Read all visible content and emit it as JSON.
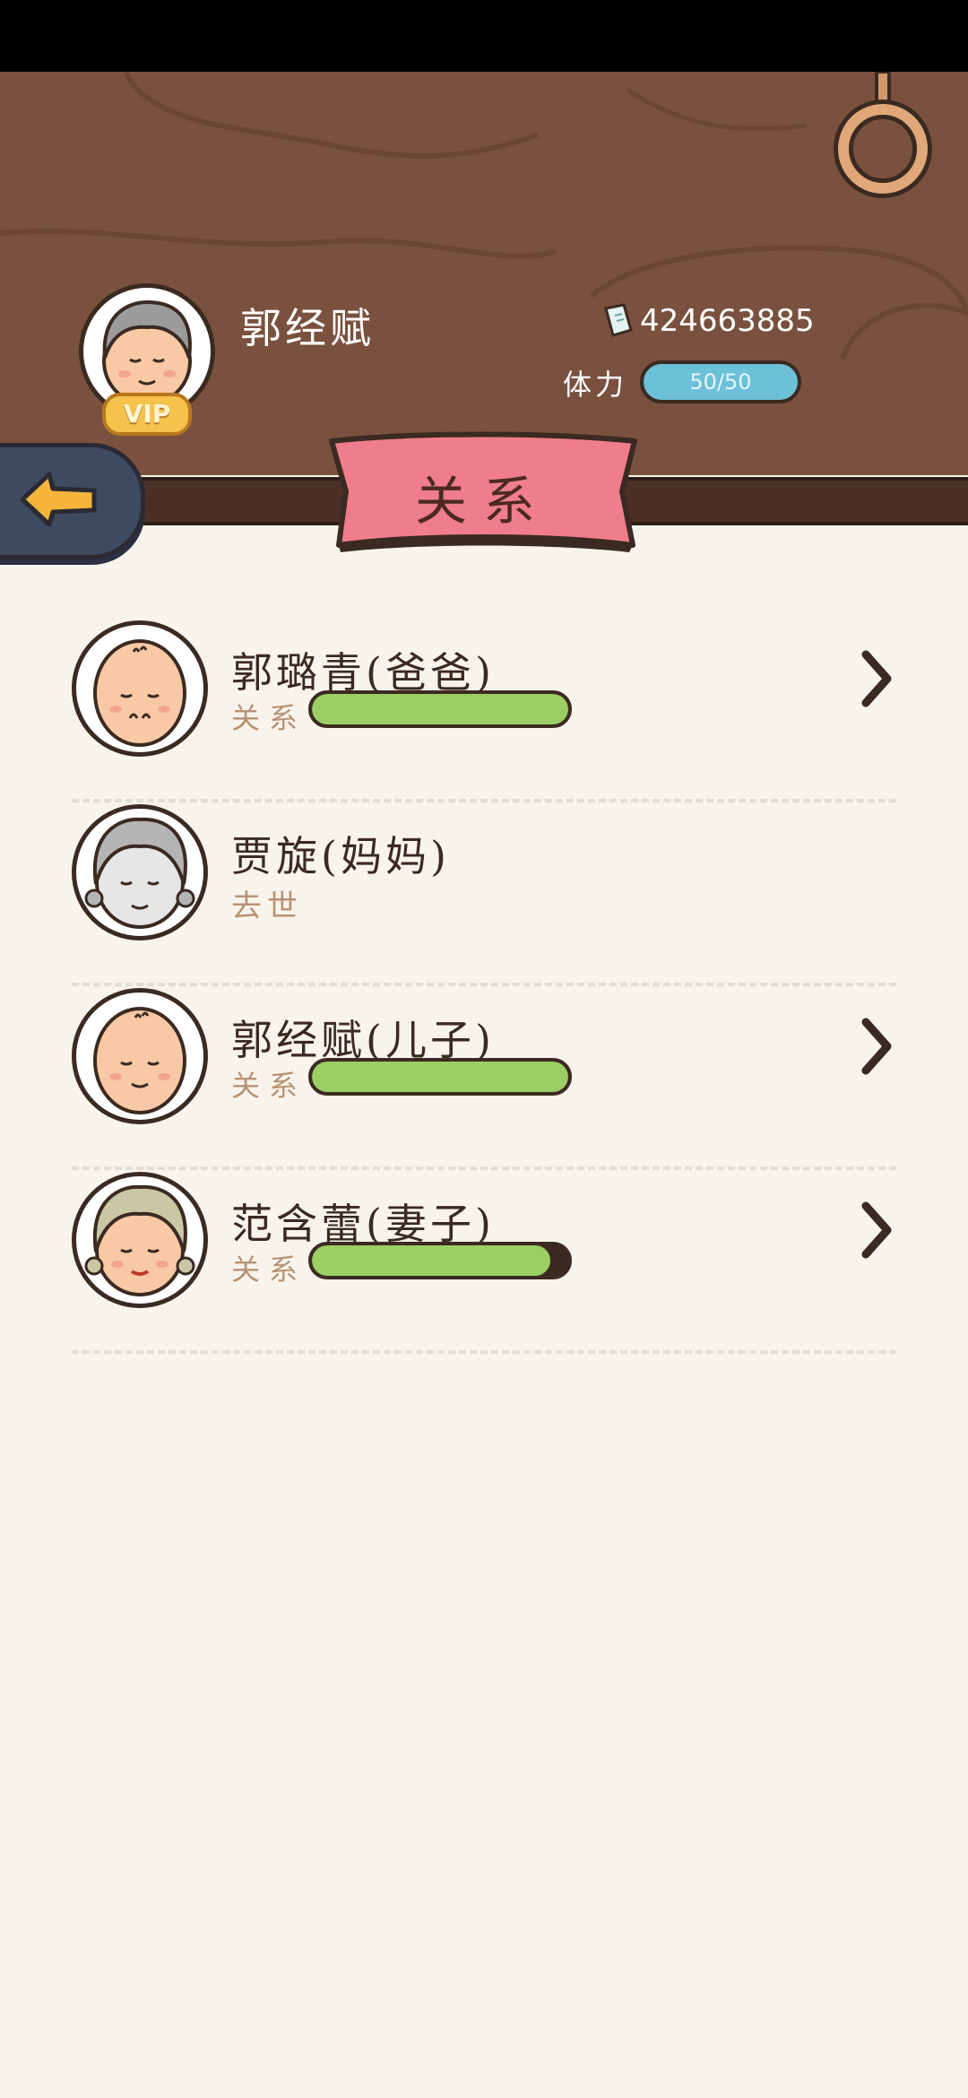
{
  "player": {
    "name": "郭经赋",
    "vip_label": "VIP",
    "currency_amount": "424663885",
    "stamina_label": "体力",
    "stamina_value": "50/50",
    "stamina_fraction": 1.0
  },
  "page_title": "关系",
  "relations": [
    {
      "name": "郭璐青(爸爸)",
      "label": "关系",
      "level": 1.0,
      "status": "",
      "avatar": "old-man-face-icon",
      "has_detail": true
    },
    {
      "name": "贾旋(妈妈)",
      "label": "",
      "level": null,
      "status": "去世",
      "avatar": "old-woman-face-gray-icon",
      "has_detail": false
    },
    {
      "name": "郭经赋(儿子)",
      "label": "关系",
      "level": 1.0,
      "status": "",
      "avatar": "man-face-icon",
      "has_detail": true
    },
    {
      "name": "范含蕾(妻子)",
      "label": "关系",
      "level": 0.93,
      "status": "",
      "avatar": "woman-face-icon",
      "has_detail": true
    }
  ],
  "colors": {
    "header_wood": "#7a513e",
    "banner_pink": "#f07d8c",
    "bar_green": "#9ccf63",
    "stamina_blue": "#6cc0d8",
    "background": "#f8f4ec"
  }
}
